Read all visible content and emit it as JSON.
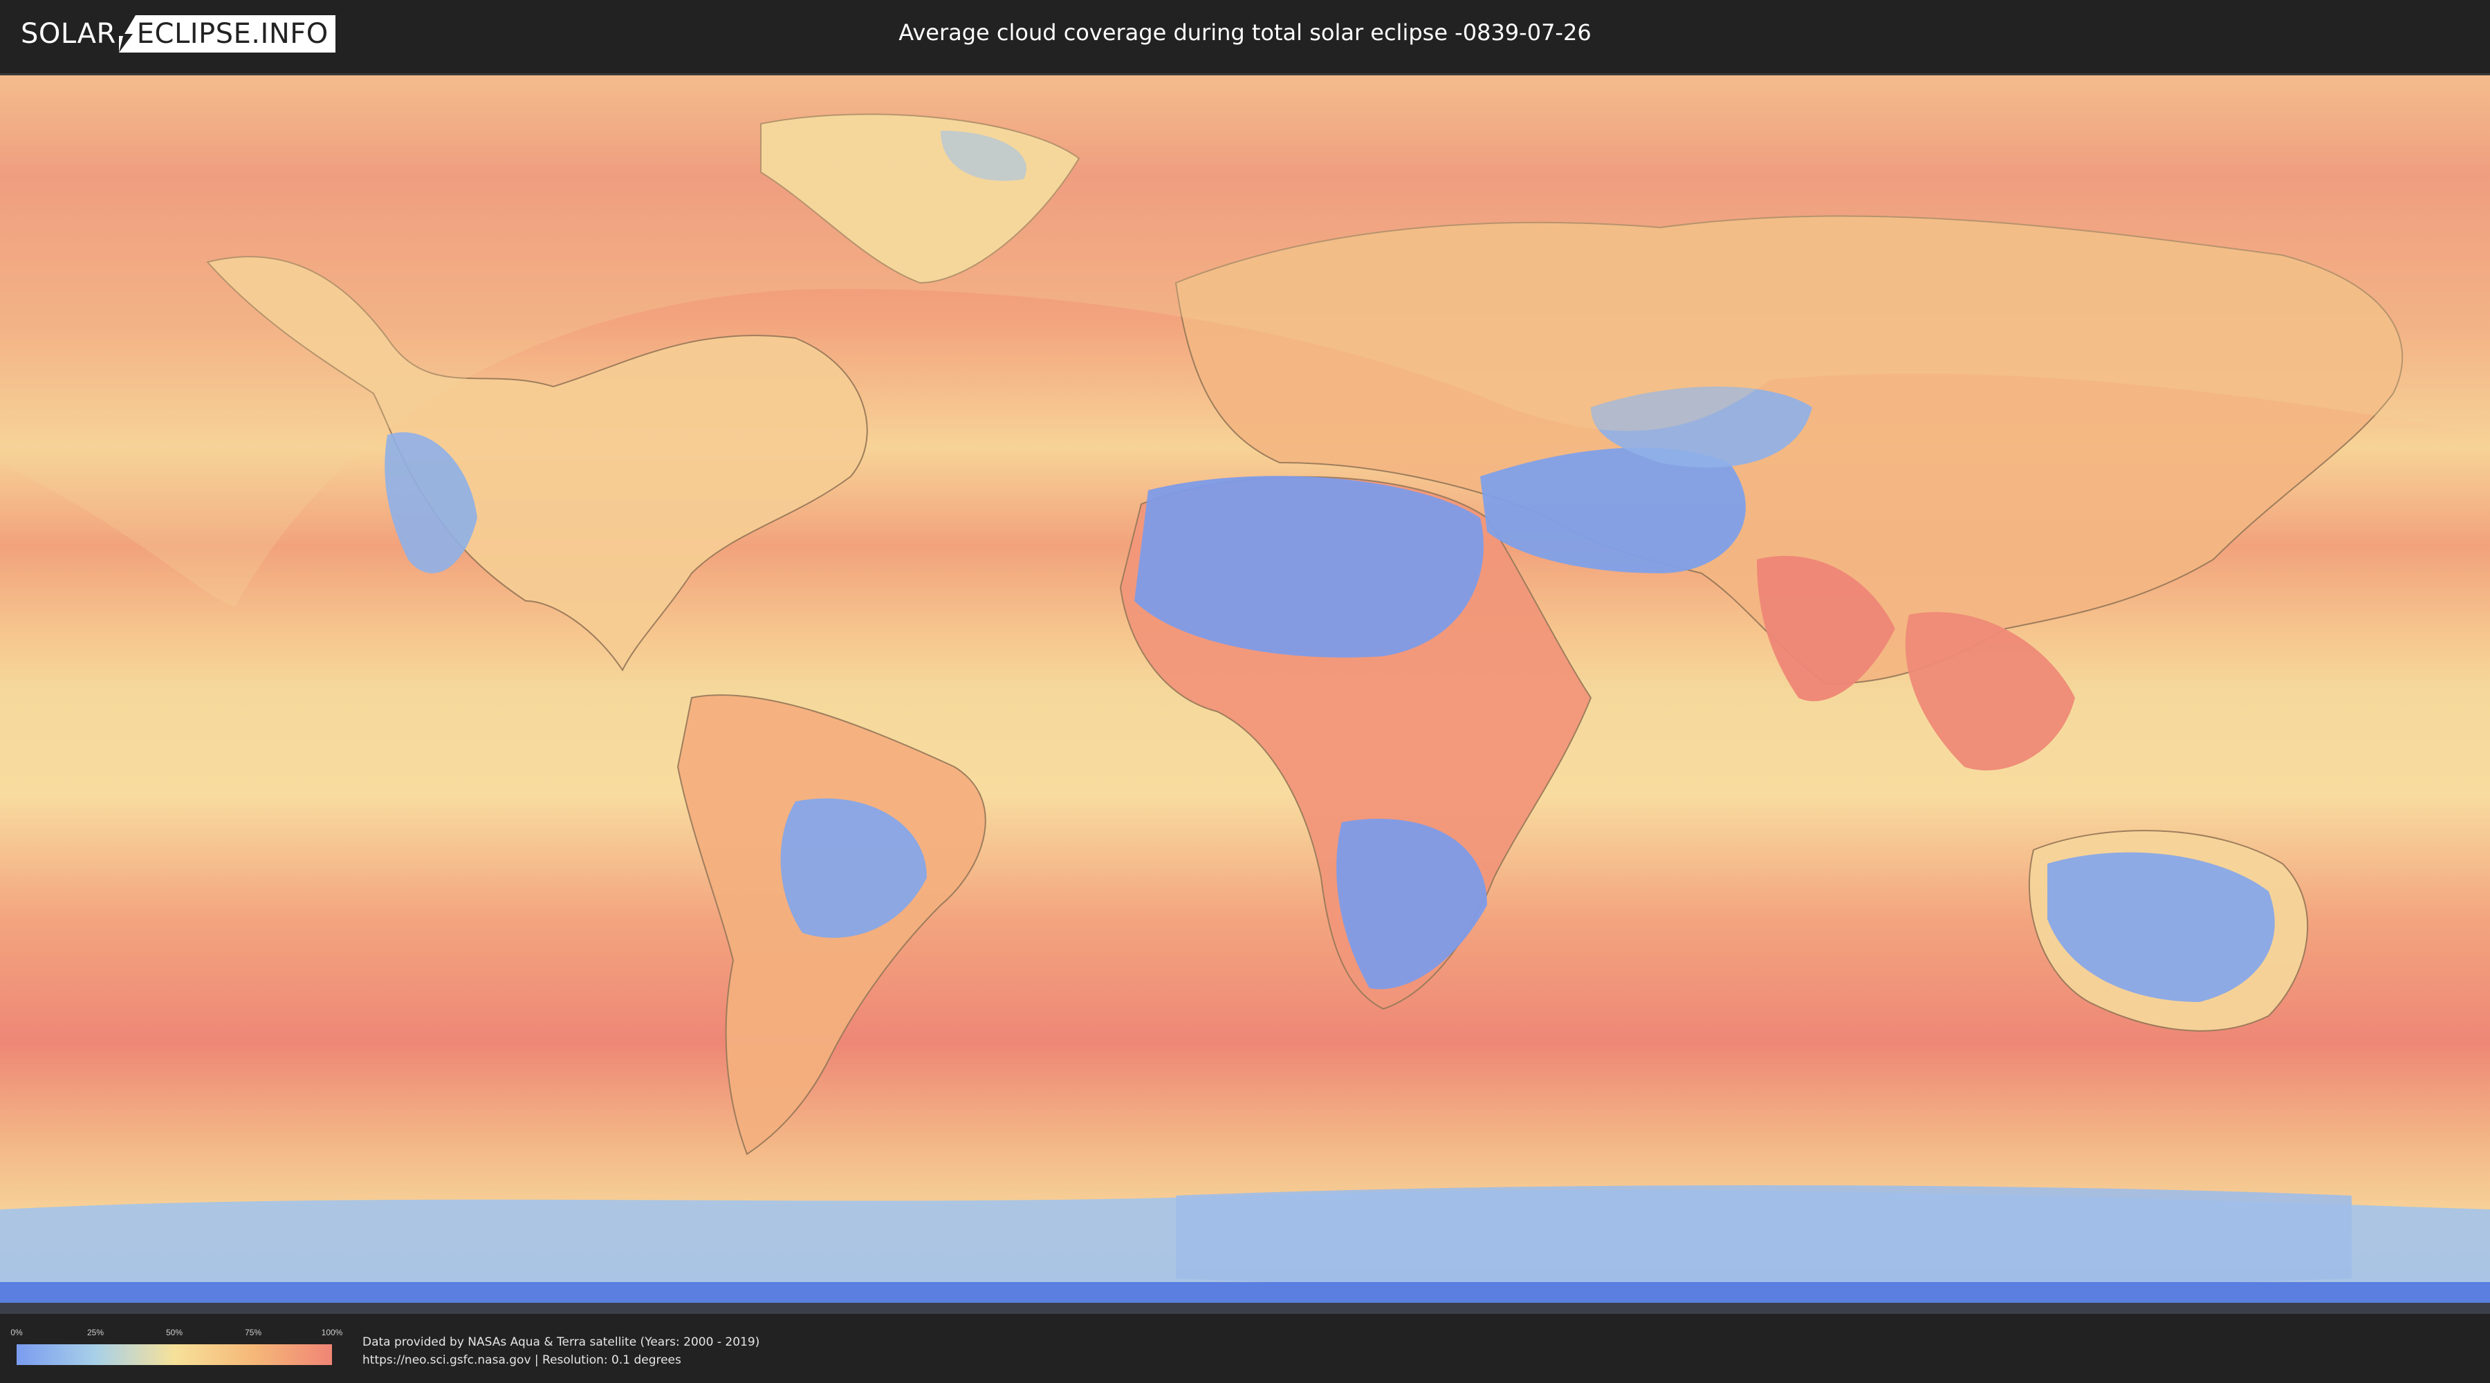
{
  "header": {
    "logo_left": "SOLAR",
    "logo_right": "ECLIPSE.INFO",
    "title": "Average cloud coverage during total solar eclipse -0839-07-26"
  },
  "legend": {
    "ticks": [
      "0%",
      "25%",
      "50%",
      "75%",
      "100%"
    ],
    "colors": [
      "#7a9cf0",
      "#a8d0e8",
      "#f6e19a",
      "#f5b878",
      "#f08576"
    ]
  },
  "footer": {
    "source_line": "Data provided by NASAs Aqua & Terra satellite (Years: 2000 - 2019)",
    "url_line": "https://neo.sci.gsfc.nasa.gov | Resolution: 0.1 degrees"
  },
  "map": {
    "ocean_color": "#f3a87e",
    "cloudy_color": "#ee8676",
    "clear_color": "#7d9be8",
    "eclipse_overlay_color": "#f4d49a"
  }
}
